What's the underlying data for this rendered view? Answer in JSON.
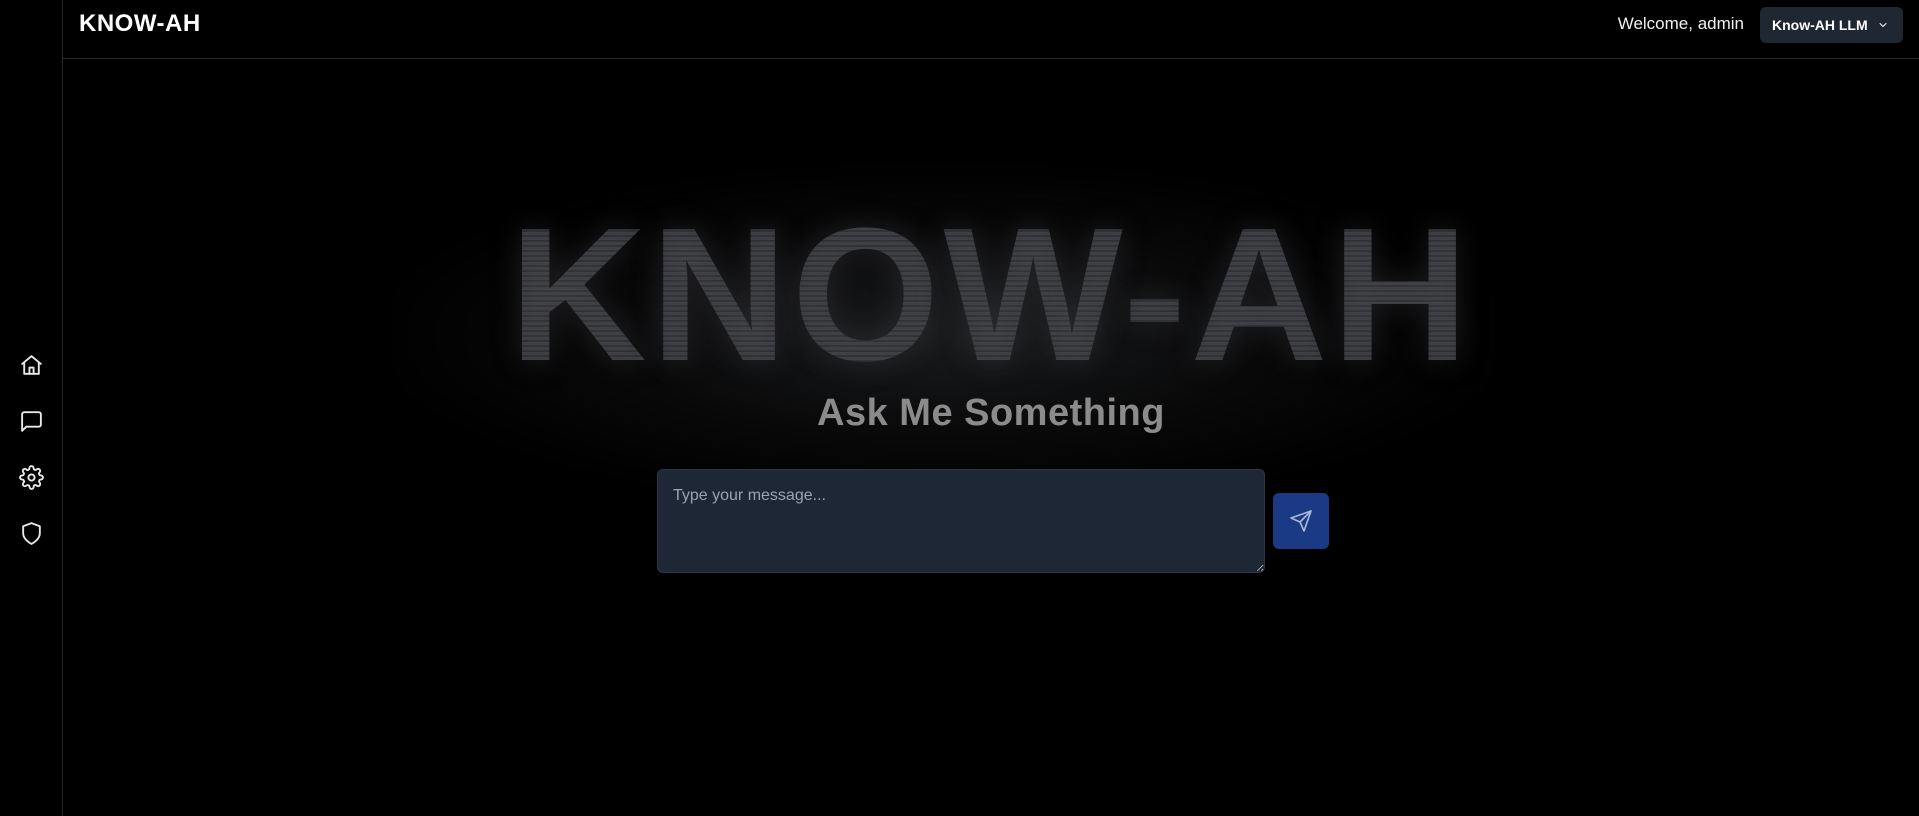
{
  "app": {
    "brand": "KNOW-AH"
  },
  "header": {
    "welcome_text": "Welcome, admin",
    "model_select": {
      "selected": "Know-AH LLM",
      "icon": "chevron-down-icon"
    }
  },
  "sidebar": {
    "items": [
      {
        "name": "home",
        "icon": "home-icon"
      },
      {
        "name": "chat",
        "icon": "message-square-icon"
      },
      {
        "name": "settings",
        "icon": "gear-icon"
      },
      {
        "name": "security",
        "icon": "shield-icon"
      }
    ]
  },
  "main": {
    "hero_text": "KNOW-AH",
    "subtitle": "Ask Me Something",
    "input": {
      "placeholder": "Type your message...",
      "value": ""
    },
    "send_button": {
      "icon": "send-icon"
    }
  },
  "colors": {
    "background": "#000000",
    "input_bg": "#1e2735",
    "send_button_bg": "#1a3a86",
    "select_bg": "#1f2733"
  }
}
